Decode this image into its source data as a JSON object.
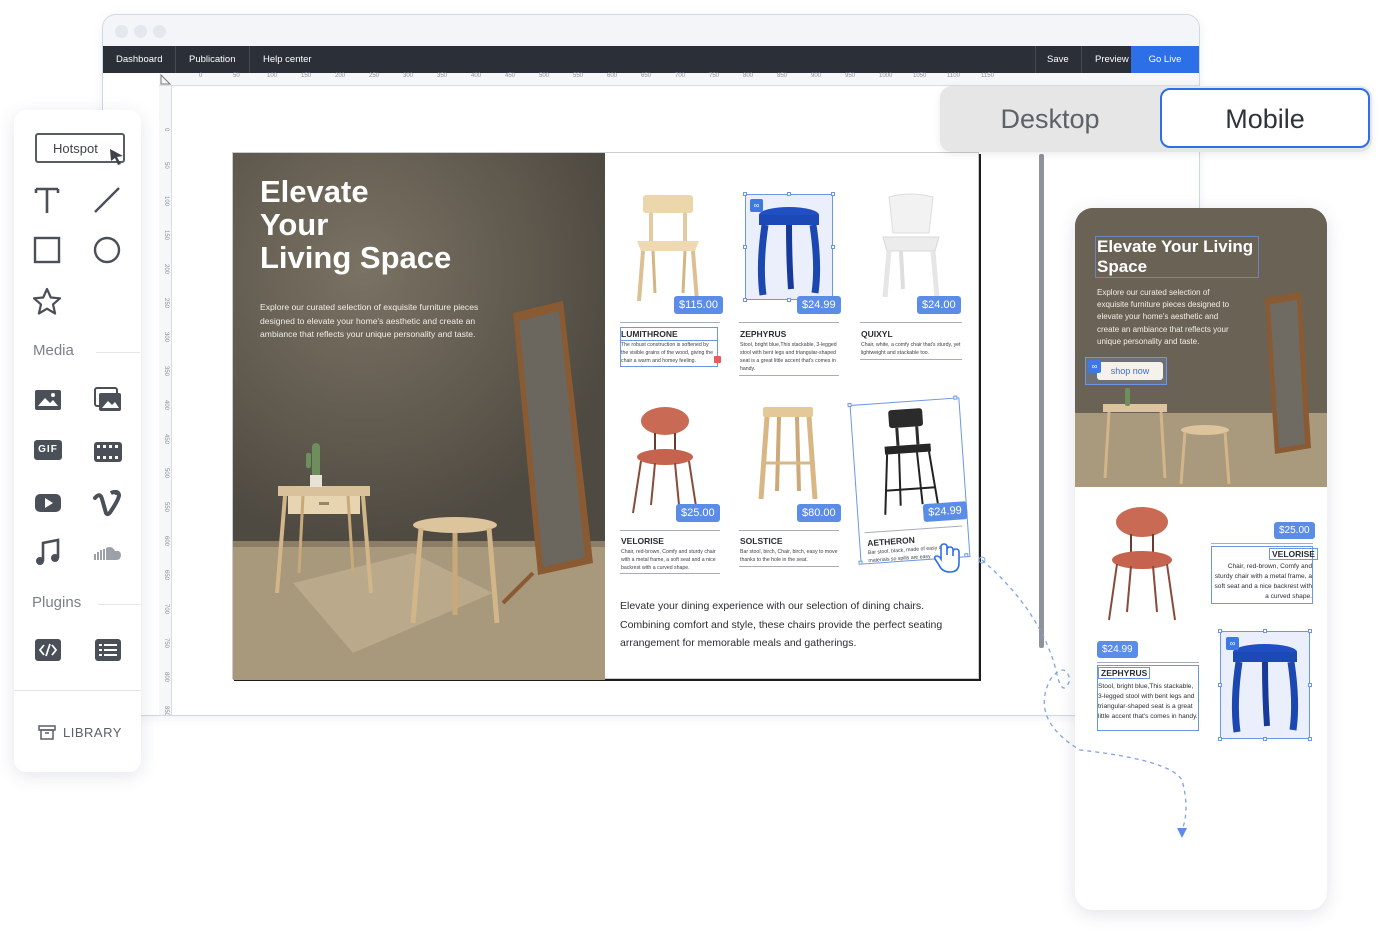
{
  "app_nav": {
    "dashboard": "Dashboard",
    "publication": "Publication",
    "help": "Help center",
    "save": "Save",
    "preview": "Preview",
    "go_live": "Go Live"
  },
  "ruler": {
    "h_ticks": [
      "0",
      "50",
      "100",
      "150",
      "200",
      "250",
      "300",
      "350",
      "400",
      "450",
      "500",
      "550",
      "600",
      "650",
      "700",
      "750",
      "800",
      "850",
      "900",
      "950",
      "1000",
      "1050",
      "1100",
      "1150"
    ],
    "v_ticks": [
      "0",
      "50",
      "100",
      "150",
      "200",
      "250",
      "300",
      "350",
      "400",
      "450",
      "500",
      "550",
      "600",
      "650",
      "700",
      "750",
      "800",
      "850"
    ]
  },
  "toolbar": {
    "hotspot": "Hotspot",
    "media_label": "Media",
    "plugins_label": "Plugins",
    "library": "LIBRARY",
    "gif": "GIF"
  },
  "view_toggle": {
    "desktop": "Desktop",
    "mobile": "Mobile",
    "selected": "Mobile"
  },
  "spread": {
    "hero_title_1": "Elevate",
    "hero_title_2": "Your",
    "hero_title_3": "Living Space",
    "hero_text": "Explore our curated selection of exquisite furniture pieces designed to elevate your home's aesthetic and create an ambiance that reflects your unique personality and taste.",
    "products": [
      {
        "name": "LUMITHRONE",
        "price": "$115.00",
        "desc": "The robust construction is softened by the visible grains of the wood, giving the chair a warm and homey feeling."
      },
      {
        "name": "ZEPHYRUS",
        "price": "$24.99",
        "desc": "Stool, bright blue,This stackable, 3-legged stool with bent legs and triangular-shaped seat is a great little accent that's comes in handy."
      },
      {
        "name": "QUIXYL",
        "price": "$24.00",
        "desc": "Chair, white, a comfy chair that's sturdy, yet lightweight and stackable too."
      },
      {
        "name": "VELORISE",
        "price": "$25.00",
        "desc": "Chair, red-brown, Comfy and sturdy chair with a metal frame, a soft seat and a nice backrest with a curved shape."
      },
      {
        "name": "SOLSTICE",
        "price": "$80.00",
        "desc": "Bar stool, birch, Chair, birch, easy to move thanks to the hole in the seat."
      },
      {
        "name": "AETHERON",
        "price": "$24.99",
        "desc": "Bar stool, black, made of easy care materials so spills are easy"
      }
    ],
    "footer_text": "Elevate your dining experience with our selection of dining chairs. Combining comfort and style, these chairs provide the perfect seating arrangement for memorable meals and gatherings."
  },
  "mobile": {
    "title": "Elevate Your Living Space",
    "text": "Explore our curated selection of exquisite furniture pieces designed to elevate your home's aesthetic and create an ambiance that reflects your unique personality and taste.",
    "button": "shop now",
    "p1_price": "$25.00",
    "p1_name": "VELORISE",
    "p1_desc": "Chair, red-brown, Comfy and sturdy chair with a metal frame, a soft seat and a nice backrest with a curved shape.",
    "p2_price": "$24.99",
    "p2_name": "ZEPHYRUS",
    "p2_desc": "Stool, bright blue,This stackable, 3-legged stool with bent legs and triangular-shaped seat is a great little accent that's comes in handy."
  },
  "colors": {
    "accent": "#2d6fe6",
    "price_badge": "#5b8de8",
    "nav_bg": "#2a2f38"
  }
}
